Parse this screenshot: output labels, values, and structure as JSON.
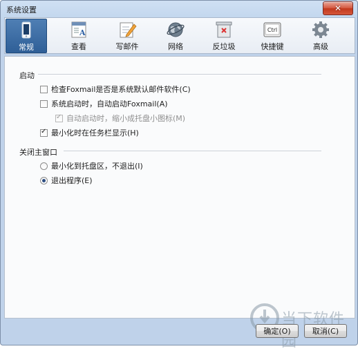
{
  "window": {
    "title": "系统设置",
    "close_glyph": "✕"
  },
  "toolbar": {
    "items": [
      {
        "label": "常规",
        "icon": "phone-icon",
        "active": true
      },
      {
        "label": "查看",
        "icon": "document-view-icon",
        "active": false
      },
      {
        "label": "写邮件",
        "icon": "compose-pencil-icon",
        "active": false
      },
      {
        "label": "网络",
        "icon": "globe-network-icon",
        "active": false
      },
      {
        "label": "反垃圾",
        "icon": "trash-bin-icon",
        "active": false
      },
      {
        "label": "快捷键",
        "icon": "keyboard-ctrl-icon",
        "active": false,
        "key_text": "Ctrl"
      },
      {
        "label": "高级",
        "icon": "gear-icon",
        "active": false
      }
    ]
  },
  "startup": {
    "title": "启动",
    "options": [
      {
        "label": "检查Foxmail是否是系统默认邮件软件(C)",
        "checked": false,
        "enabled": true
      },
      {
        "label": "系统启动时，自动启动Foxmail(A)",
        "checked": false,
        "enabled": true
      },
      {
        "label": "自动启动时，缩小成托盘小图标(M)",
        "checked": true,
        "enabled": false
      },
      {
        "label": "最小化时在任务栏显示(H)",
        "checked": true,
        "enabled": true
      }
    ]
  },
  "close_main": {
    "title": "关闭主窗口",
    "options": [
      {
        "label": "最小化到托盘区，不退出(I)",
        "selected": false
      },
      {
        "label": "退出程序(E)",
        "selected": true
      }
    ]
  },
  "buttons": {
    "ok": "确定(O)",
    "cancel": "取消(C)"
  },
  "watermark": {
    "text": "当下软件园"
  },
  "colors": {
    "active_tab": "#3a6aa3",
    "window_bg": "#c3d7ee",
    "close_red": "#c8432a"
  }
}
